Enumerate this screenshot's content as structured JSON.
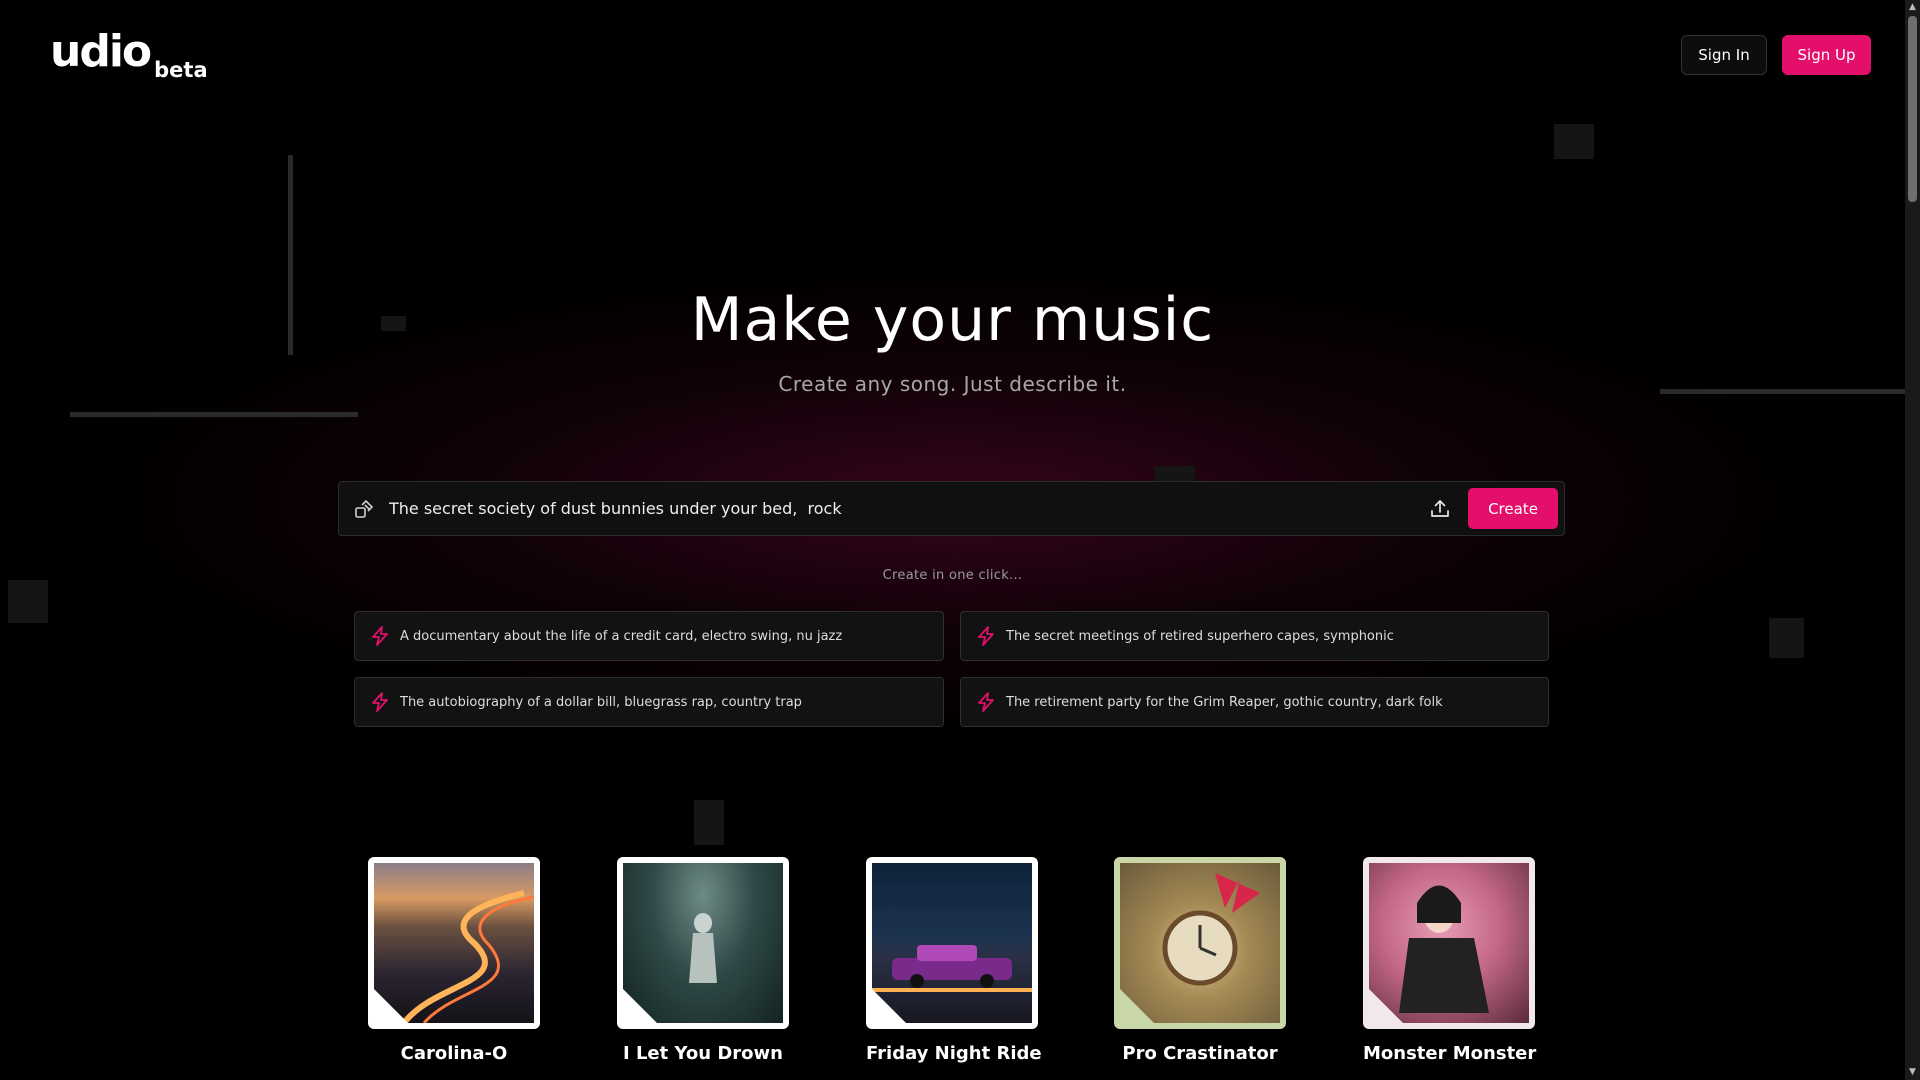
{
  "brand": {
    "name": "udio",
    "tag": "beta"
  },
  "auth": {
    "sign_in": "Sign In",
    "sign_up": "Sign Up"
  },
  "hero": {
    "title": "Make your music",
    "subtitle": "Create any song. Just describe it."
  },
  "prompt": {
    "value": "The secret society of dust bunnies under your bed,  rock",
    "create_label": "Create",
    "icon_left": "shuffle-icon",
    "icon_right": "upload-icon"
  },
  "one_click_label": "Create in one click...",
  "suggestions": [
    {
      "text": "A documentary about the life of a credit card, electro swing, nu jazz",
      "icon": "bolt-icon"
    },
    {
      "text": "The secret meetings of retired superhero capes, symphonic",
      "icon": "bolt-icon"
    },
    {
      "text": "The autobiography of a dollar bill, bluegrass rap, country trap",
      "icon": "bolt-icon"
    },
    {
      "text": "The retirement party for the Grim Reaper, gothic country, dark folk",
      "icon": "bolt-icon"
    }
  ],
  "tracks": [
    {
      "title": "Carolina-O",
      "artist": ""
    },
    {
      "title": "I Let You Drown",
      "artist": ""
    },
    {
      "title": "Friday Night Ride",
      "artist": ""
    },
    {
      "title": "Pro Crastinator",
      "artist": ""
    },
    {
      "title": "Monster Monster",
      "artist": ""
    }
  ],
  "colors": {
    "accent": "#e30f6b",
    "background": "#000000"
  }
}
